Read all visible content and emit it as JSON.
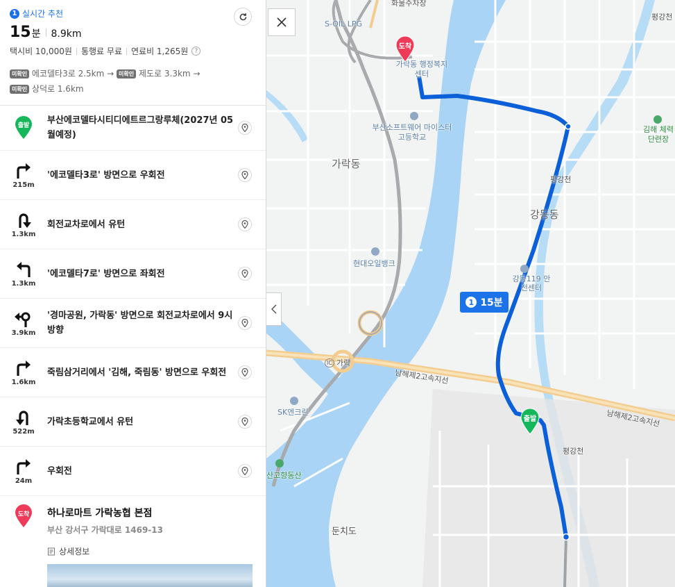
{
  "summary": {
    "rank": "1",
    "realtime_label": "실시간 추천",
    "time_value": "15",
    "time_unit": "분",
    "distance": "8.9km",
    "taxi": "택시비 10,000원",
    "toll": "통행료 무료",
    "fuel": "연료비 1,265원",
    "help": "?",
    "roads": [
      {
        "tag": "미확인",
        "name": "에코델타3로 2.5km"
      },
      {
        "tag": "미확인",
        "name": "제도로 3.3km"
      },
      {
        "tag": "미확인",
        "name": "상덕로 1.6km"
      }
    ],
    "arrow": "→"
  },
  "steps": {
    "start": {
      "badge": "출발",
      "text": "부산에코델타시티디에트르그랑루체(2027년 05월예정)"
    },
    "s1": {
      "icon": "turn-right-icon",
      "distance": "215m",
      "text": "'에코델타3로' 방면으로 우회전"
    },
    "s2": {
      "icon": "u-turn-icon",
      "distance": "1.3km",
      "text": "회전교차로에서 유턴"
    },
    "s3": {
      "icon": "turn-left-icon",
      "distance": "1.3km",
      "text": "'에코델타7로' 방면으로 좌회전"
    },
    "s4": {
      "icon": "roundabout-icon",
      "distance": "3.9km",
      "text": "'경마공원, 가락동' 방면으로 회전교차로에서 9시 방향"
    },
    "s5": {
      "icon": "turn-right-icon",
      "distance": "1.6km",
      "text": "죽림삼거리에서 '김해, 죽림동' 방면으로 우회전"
    },
    "s6": {
      "icon": "u-turn-icon",
      "distance": "522m",
      "text": "가락초등학교에서 유턴"
    },
    "s7": {
      "icon": "turn-right-icon",
      "distance": "24m",
      "text": "우회전"
    },
    "end": {
      "badge": "도착",
      "title": "하나로마트 가락농협 본점",
      "address": "부산 강서구 가락대로 1469-13",
      "detail": "상세정보"
    }
  },
  "map": {
    "route_badge_num": "1",
    "route_badge_time": "15분",
    "start_marker": "출발",
    "end_marker": "도착",
    "labels": {
      "soil": "S-OIL LPG",
      "top_cut": "화물주차장",
      "admin": "가락동 행정복지센터",
      "school": "부산소프트웨어 마이스터고등학교",
      "garak": "가락동",
      "bank": "현대오일뱅크",
      "ic": "가락",
      "ic_tag": "IC",
      "sk": "SK엔크린",
      "hill": "산고향동산",
      "dunchi": "둔치도",
      "pyeonggang_top": "평강천",
      "gangdong": "강동동",
      "safety": "강동119 안전센터",
      "pyeonggang_mid": "평강천",
      "pyeonggang_low": "평강천",
      "highway1": "남해제2고속지선",
      "highway2": "남해제2고속지선",
      "pyeonggang_tr": "평강천",
      "gimhae": "김해 체력단련장"
    }
  },
  "colors": {
    "route": "#0b5fd8",
    "accent": "#1a73e8",
    "start": "#14b85a",
    "end": "#ef3b5a"
  }
}
